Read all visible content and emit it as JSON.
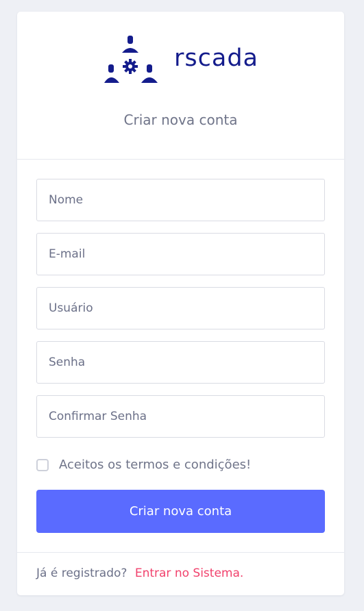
{
  "brand": {
    "logo_text": "rscada",
    "color": "#141c8c"
  },
  "header": {
    "title": "Criar nova conta"
  },
  "form": {
    "name_placeholder": "Nome",
    "email_placeholder": "E-mail",
    "username_placeholder": "Usuário",
    "password_placeholder": "Senha",
    "confirm_password_placeholder": "Confirmar Senha",
    "terms_label": "Aceitos os termos e condições!",
    "terms_checked": false,
    "submit_label": "Criar nova conta",
    "submit_color": "#5a6bff"
  },
  "footer": {
    "prompt": "Já é registrado?",
    "login_link": "Entrar no Sistema.",
    "link_color": "#f1416c"
  },
  "icons": {
    "logo": "people-gear-icon"
  }
}
